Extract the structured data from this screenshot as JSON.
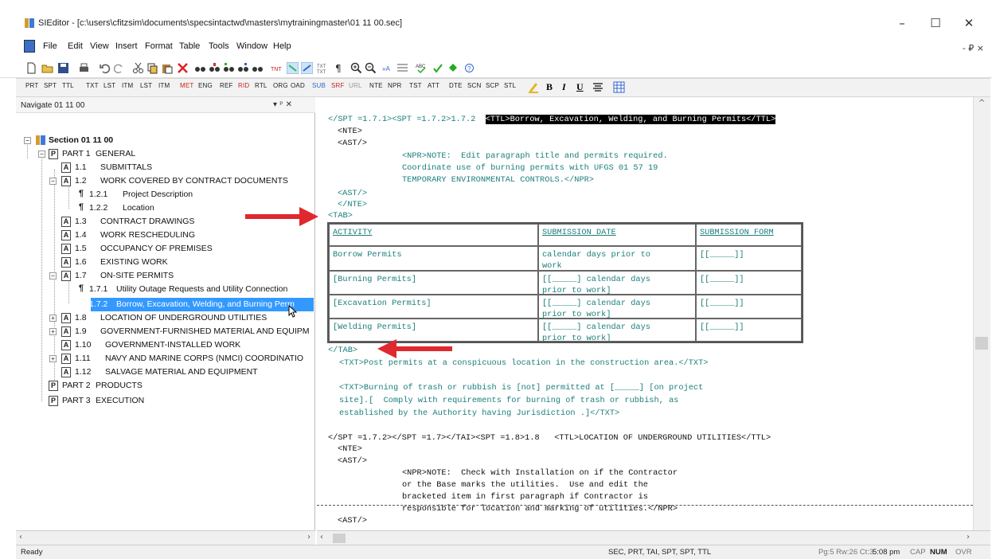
{
  "window": {
    "title": "SIEditor - [c:\\users\\cfitzsim\\documents\\specsintactwd\\masters\\mytrainingmaster\\01 11 00.sec]",
    "controls": {
      "minimize": "–",
      "maximize": "☐",
      "close": "✕"
    }
  },
  "menu": [
    "File",
    "Edit",
    "View",
    "Insert",
    "Format",
    "Table",
    "Tools",
    "Window",
    "Help"
  ],
  "mdi_controls": "- ₽ ×",
  "tag_toolbar": [
    "PRT",
    "SPT",
    "TTL",
    "TXT",
    "LST",
    "ITM",
    "LST",
    "ITM",
    "MET",
    "ENG",
    "REF",
    "RID",
    "RTL",
    "ORG",
    "OAD",
    "SUB",
    "SRF",
    "URL",
    "NTE",
    "NPR",
    "TST",
    "ATT",
    "DTE",
    "SCN",
    "SCP",
    "STL"
  ],
  "nav": {
    "title": "Navigate 01 11 00",
    "controls": "▾ ᵖ ✕",
    "tree": [
      {
        "num": "",
        "label": "Section 01 11 00"
      },
      {
        "num": "PART 1",
        "label": "GENERAL"
      },
      {
        "num": "1.1",
        "label": "SUBMITTALS"
      },
      {
        "num": "1.2",
        "label": "WORK COVERED BY CONTRACT DOCUMENTS"
      },
      {
        "num": "1.2.1",
        "label": "Project Description"
      },
      {
        "num": "1.2.2",
        "label": "Location"
      },
      {
        "num": "1.3",
        "label": "CONTRACT DRAWINGS"
      },
      {
        "num": "1.4",
        "label": "WORK RESCHEDULING"
      },
      {
        "num": "1.5",
        "label": "OCCUPANCY OF PREMISES"
      },
      {
        "num": "1.6",
        "label": "EXISTING WORK"
      },
      {
        "num": "1.7",
        "label": "ON-SITE PERMITS"
      },
      {
        "num": "1.7.1",
        "label": "Utility Outage Requests and Utility Connection"
      },
      {
        "num": "1.7.2",
        "label": "Borrow, Excavation, Welding, and Burning Perm"
      },
      {
        "num": "1.8",
        "label": "LOCATION OF UNDERGROUND UTILITIES"
      },
      {
        "num": "1.9",
        "label": "GOVERNMENT-FURNISHED MATERIAL AND EQUIPM"
      },
      {
        "num": "1.10",
        "label": "GOVERNMENT-INSTALLED WORK"
      },
      {
        "num": "1.11",
        "label": "NAVY AND MARINE CORPS (NMCI) COORDINATIO"
      },
      {
        "num": "1.12",
        "label": "SALVAGE MATERIAL AND EQUIPMENT"
      },
      {
        "num": "PART 2",
        "label": "PRODUCTS"
      },
      {
        "num": "PART 3",
        "label": "EXECUTION"
      }
    ]
  },
  "editor": {
    "l1_a": "</SPT =1.7.1><SPT =1.7.2>1.7.2  ",
    "l1_b": "<TTL>Borrow, Excavation, Welding, and Burning Permits</TTL>",
    "l2": "<NTE>",
    "l3": "<AST/>",
    "l4": "<NPR>NOTE:  Edit paragraph title and permits required.",
    "l5": "Coordinate use of burning permits with UFGS 01 57 19",
    "l6": "TEMPORARY ENVIRONMENTAL CONTROLS.</NPR>",
    "l7": "<AST/>",
    "l8": "</NTE>",
    "l9": "<TAB>",
    "table": {
      "headers": [
        "ACTIVITY",
        "SUBMISSION DATE",
        "SUBMISSION FORM"
      ],
      "rows": [
        [
          "Borrow Permits",
          "calendar days prior to",
          "work",
          "[[_____]]"
        ],
        [
          "[Burning Permits]",
          "[[_____] calendar days",
          "prior to work]",
          "[[_____]]"
        ],
        [
          "[Excavation Permits]",
          "[[_____] calendar days",
          "prior to work]",
          "[[_____]]"
        ],
        [
          "[Welding Permits]",
          "[[_____] calendar days",
          "prior to work]",
          "[[_____]]"
        ]
      ]
    },
    "l10": "</TAB>",
    "l11": "<TXT>Post permits at a conspicuous location in the construction area.</TXT>",
    "l12": "<TXT>Burning of trash or rubbish is [not] permitted at [_____] [on project",
    "l13": "site].[  Comply with requirements for burning of trash or rubbish, as",
    "l14": "established by the Authority having Jurisdiction .]</TXT>",
    "l15": "</SPT =1.7.2></SPT =1.7></TAI><SPT =1.8>1.8   <TTL>LOCATION OF UNDERGROUND UTILITIES</TTL>",
    "l16": "<NTE>",
    "l17": "<AST/>",
    "l18": "<NPR>NOTE:  Check with Installation on if the Contractor",
    "l19": "or the Base marks the utilities.  Use and edit the",
    "l20": "bracketed item in first paragraph if Contractor is",
    "l21": "responsible for location and marking of utilities.</NPR>",
    "l22": "<AST/>"
  },
  "status": {
    "ready": "Ready",
    "tags": "SEC, PRT, TAI, SPT, SPT, TTL",
    "position": "Pg:5 Rw:26 Ct:3",
    "time": "5:08 pm",
    "cap": "CAP",
    "num": "NUM",
    "ovr": "OVR"
  },
  "colors": {
    "code": "#1a7f7a",
    "selection": "#3399ff",
    "arrow": "#e0282f"
  }
}
